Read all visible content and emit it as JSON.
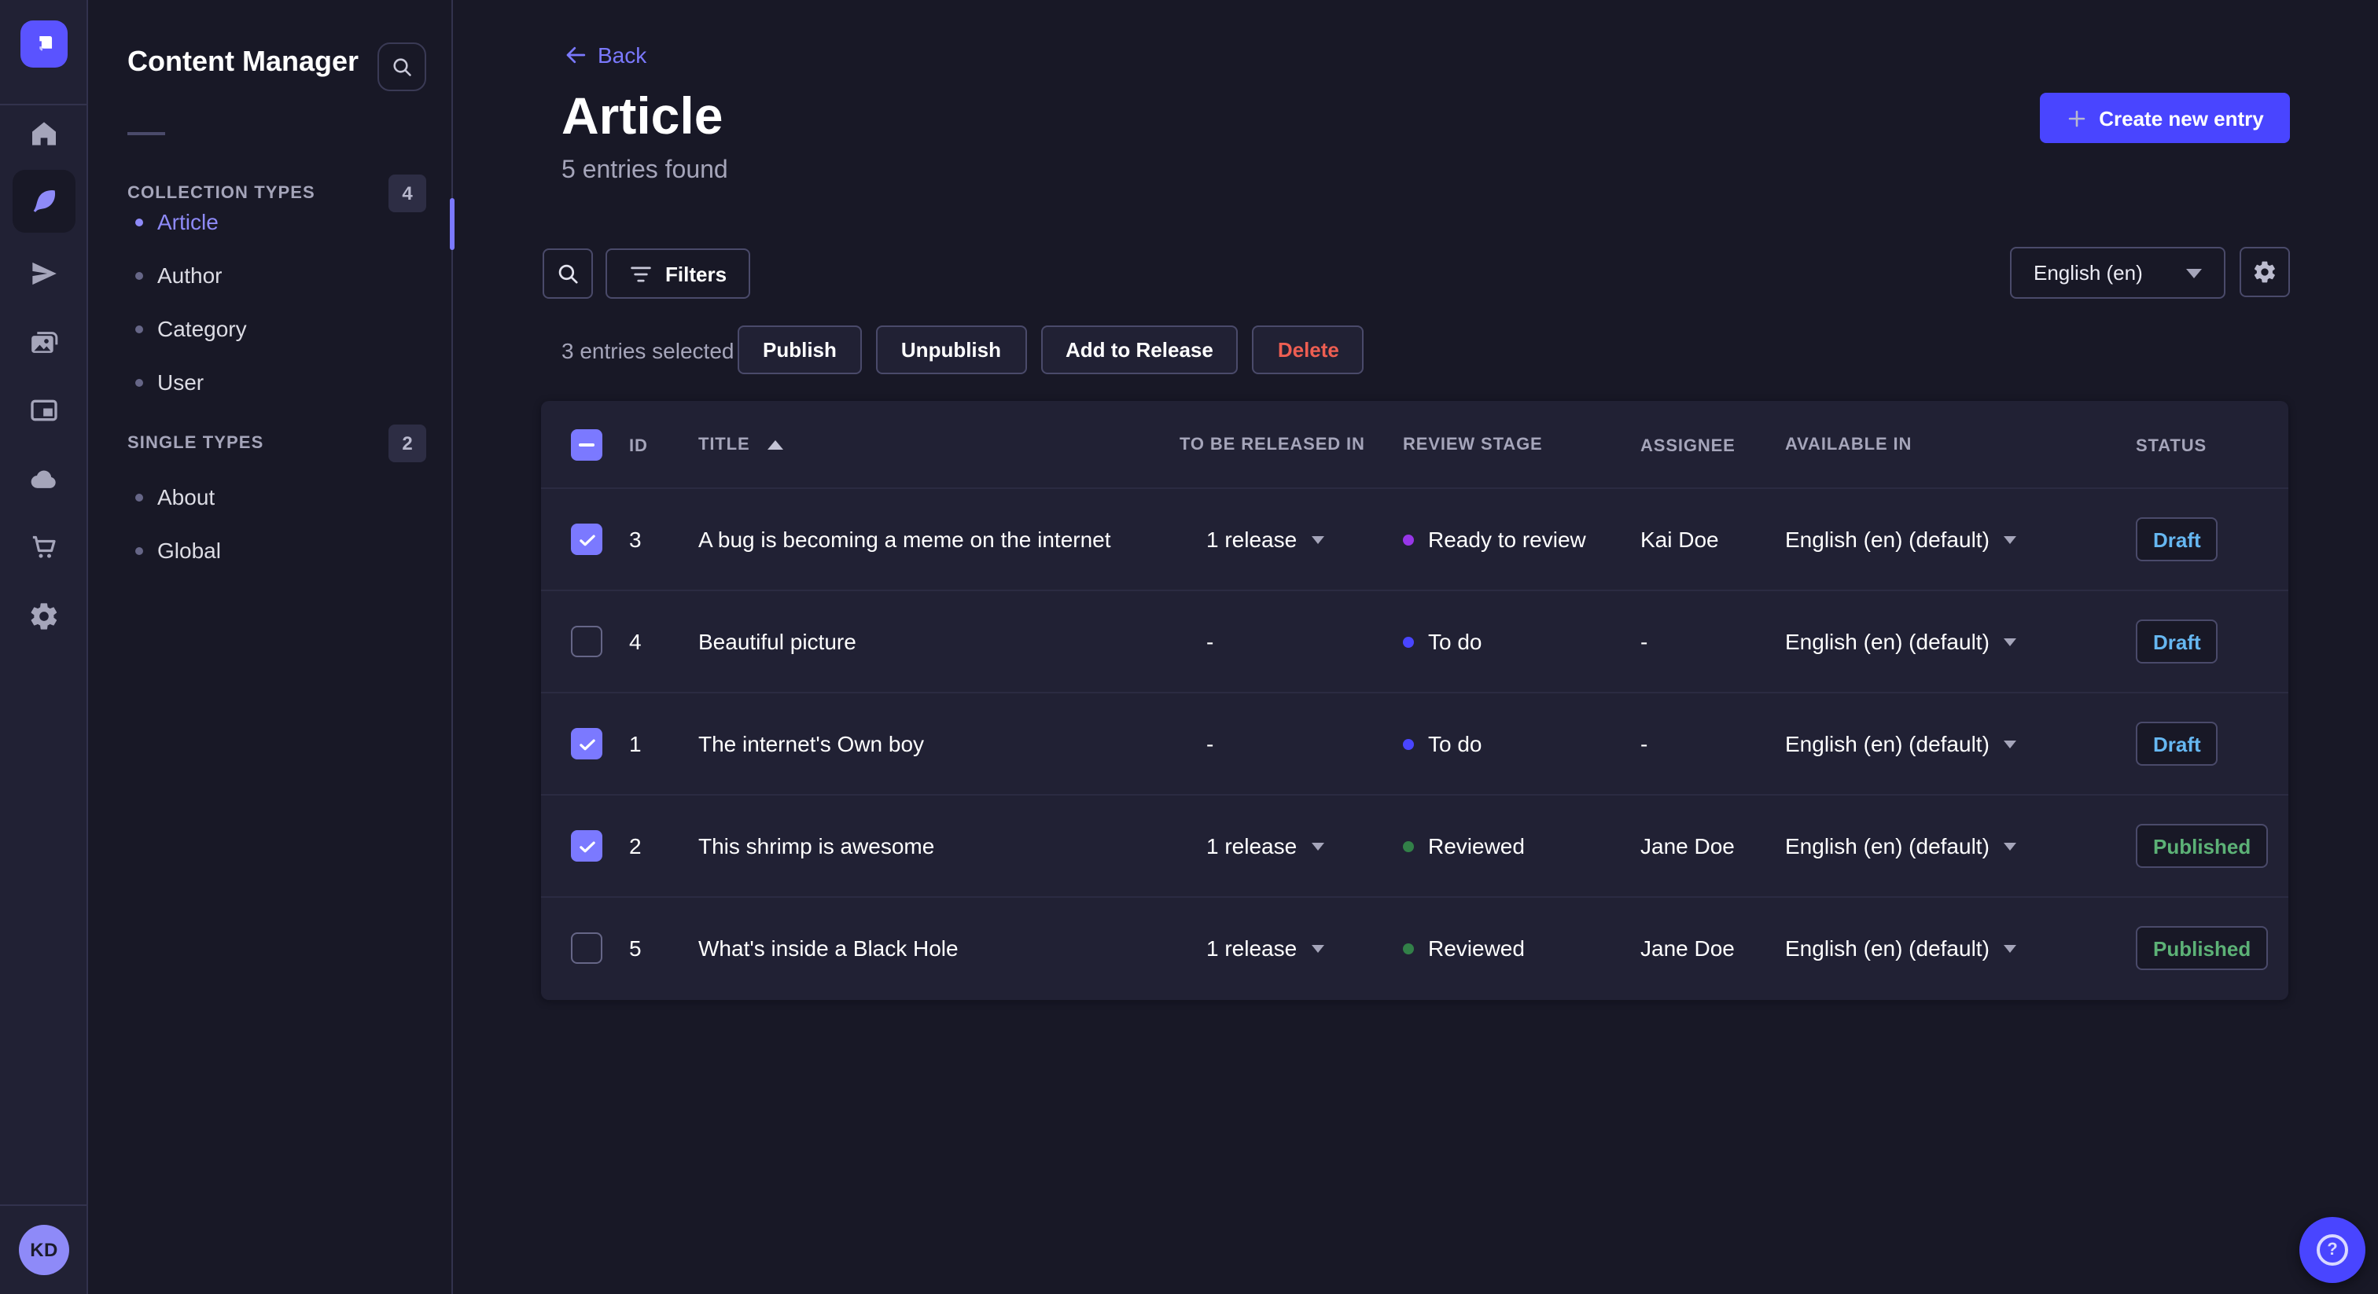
{
  "colors": {
    "primary": "#4945ff",
    "accent_purple": "#7b79ff",
    "draft": "#66b7f1",
    "published": "#5cb176",
    "danger": "#ee5e52",
    "stage_todo": "#4945ff",
    "stage_ready": "#9736e8",
    "stage_reviewed": "#328048"
  },
  "nav_rail": {
    "icons": [
      "home",
      "feather",
      "send",
      "media-library",
      "layout",
      "cloud",
      "cart",
      "settings"
    ],
    "active_icon": "feather",
    "avatar_initials": "KD"
  },
  "subnav": {
    "title": "Content Manager",
    "sections": [
      {
        "label": "COLLECTION TYPES",
        "count": "4",
        "items": [
          {
            "label": "Article",
            "active": true
          },
          {
            "label": "Author"
          },
          {
            "label": "Category"
          },
          {
            "label": "User"
          }
        ]
      },
      {
        "label": "SINGLE TYPES",
        "count": "2",
        "items": [
          {
            "label": "About"
          },
          {
            "label": "Global"
          }
        ]
      }
    ]
  },
  "header": {
    "back_label": "Back",
    "title": "Article",
    "subtitle": "5 entries found",
    "create_button_label": "Create new entry"
  },
  "toolbar": {
    "filters_label": "Filters",
    "locale_value": "English (en)"
  },
  "bulk_actions": {
    "selected_text": "3 entries selected",
    "publish_label": "Publish",
    "unpublish_label": "Unpublish",
    "add_to_release_label": "Add to Release",
    "delete_label": "Delete"
  },
  "table": {
    "select_all_state": "indeterminate",
    "sort_column": "TITLE",
    "sort_direction": "asc",
    "headers": {
      "id": "ID",
      "title": "TITLE",
      "released": "TO BE RELEASED IN",
      "review_stage": "REVIEW STAGE",
      "assignee": "ASSIGNEE",
      "available_in": "AVAILABLE IN",
      "status": "STATUS"
    },
    "rows": [
      {
        "selected": true,
        "id": "3",
        "title": "A bug is becoming a meme on the internet",
        "released_in": "1 release",
        "released_caret": true,
        "review_stage": "Ready to review",
        "stage_key": "stage_ready",
        "assignee": "Kai Doe",
        "available_in": "English (en) (default)",
        "status": "Draft",
        "status_key": "draft"
      },
      {
        "selected": false,
        "id": "4",
        "title": "Beautiful picture",
        "released_in": "-",
        "released_caret": false,
        "review_stage": "To do",
        "stage_key": "stage_todo",
        "assignee": "-",
        "available_in": "English (en) (default)",
        "status": "Draft",
        "status_key": "draft"
      },
      {
        "selected": true,
        "id": "1",
        "title": "The internet's Own boy",
        "released_in": "-",
        "released_caret": false,
        "review_stage": "To do",
        "stage_key": "stage_todo",
        "assignee": "-",
        "available_in": "English (en) (default)",
        "status": "Draft",
        "status_key": "draft"
      },
      {
        "selected": true,
        "id": "2",
        "title": "This shrimp is awesome",
        "released_in": "1 release",
        "released_caret": true,
        "review_stage": "Reviewed",
        "stage_key": "stage_reviewed",
        "assignee": "Jane Doe",
        "available_in": "English (en) (default)",
        "status": "Published",
        "status_key": "published"
      },
      {
        "selected": false,
        "id": "5",
        "title": "What's inside a Black Hole",
        "released_in": "1 release",
        "released_caret": true,
        "review_stage": "Reviewed",
        "stage_key": "stage_reviewed",
        "assignee": "Jane Doe",
        "available_in": "English (en) (default)",
        "status": "Published",
        "status_key": "published"
      }
    ]
  },
  "help": {
    "glyph": "?"
  }
}
